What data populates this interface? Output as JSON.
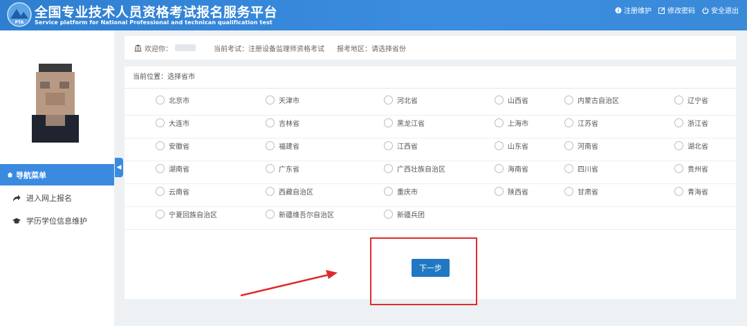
{
  "header": {
    "title_cn": "全国专业技术人员资格考试报名服务平台",
    "title_en": "Service platform for National Professional and technican qualification test",
    "links": [
      {
        "label": "注册维护",
        "icon": "info-icon"
      },
      {
        "label": "修改密码",
        "icon": "edit-icon"
      },
      {
        "label": "安全退出",
        "icon": "power-icon"
      }
    ],
    "logo_text": "PTA"
  },
  "sidebar": {
    "nav_header": "导航菜单",
    "items": [
      {
        "label": "进入网上报名",
        "icon": "share-arrow-icon"
      },
      {
        "label": "学历学位信息维护",
        "icon": "graduation-cap-icon"
      }
    ]
  },
  "info_bar": {
    "welcome": "欢迎你：",
    "current_exam": "当前考试：注册设备监理师资格考试",
    "region": "报考地区：请选择省份"
  },
  "panel": {
    "breadcrumb": "当前位置：选择省市",
    "provinces": [
      [
        "北京市",
        "天津市",
        "河北省",
        "山西省",
        "内蒙古自治区",
        "辽宁省"
      ],
      [
        "大连市",
        "吉林省",
        "黑龙江省",
        "上海市",
        "江苏省",
        "浙江省"
      ],
      [
        "安徽省",
        "福建省",
        "江西省",
        "山东省",
        "河南省",
        "湖北省"
      ],
      [
        "湖南省",
        "广东省",
        "广西壮族自治区",
        "海南省",
        "四川省",
        "贵州省"
      ],
      [
        "云南省",
        "西藏自治区",
        "重庆市",
        "陕西省",
        "甘肃省",
        "青海省"
      ],
      [
        "宁夏回族自治区",
        "新疆维吾尔自治区",
        "新疆兵团"
      ]
    ],
    "next_button": "下一步"
  },
  "colors": {
    "header_blue": "#3a8be0",
    "button_blue": "#1f78c1",
    "annotation_red": "#e02a2a"
  }
}
